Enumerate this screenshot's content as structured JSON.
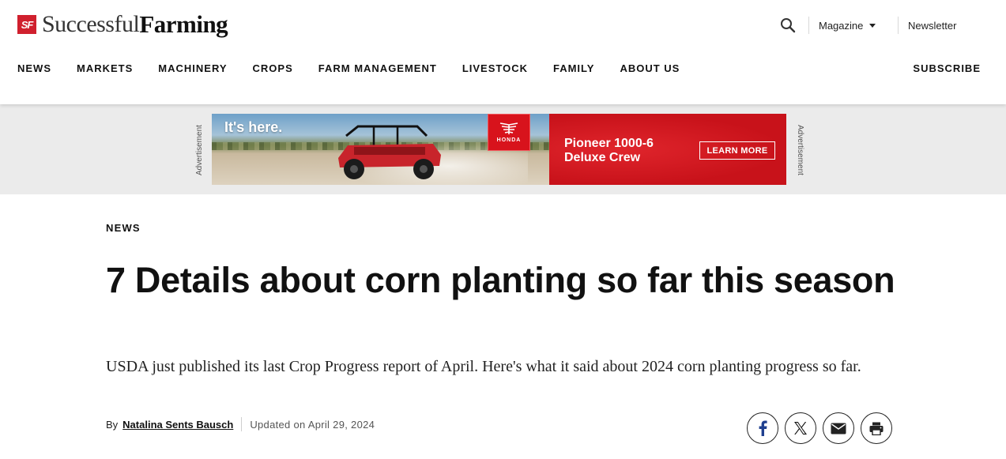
{
  "brand": {
    "badge": "SF",
    "name_light": "Successful",
    "name_bold": "Farming",
    "accent": "#d0202e"
  },
  "utility": {
    "magazine_label": "Magazine",
    "newsletter_label": "Newsletter",
    "search_icon": "search-icon"
  },
  "nav": {
    "items": [
      "NEWS",
      "MARKETS",
      "MACHINERY",
      "CROPS",
      "FARM MANAGEMENT",
      "LIVESTOCK",
      "FAMILY",
      "ABOUT US"
    ],
    "subscribe_label": "SUBSCRIBE"
  },
  "ad": {
    "label": "Advertisement",
    "headline": "It's here.",
    "brand": "HONDA",
    "title_line1": "Pioneer 1000-6",
    "title_line2": "Deluxe Crew",
    "cta": "LEARN MORE",
    "red": "#d8131c"
  },
  "article": {
    "category": "NEWS",
    "title": "7 Details about corn planting so far this season",
    "dek": "USDA just published its last Crop Progress report of April. Here's what it said about 2024 corn planting progress so far.",
    "by": "By",
    "author": "Natalina Sents Bausch",
    "updated": "Updated on April 29, 2024"
  },
  "share": [
    "facebook-icon",
    "x-icon",
    "email-icon",
    "print-icon"
  ]
}
